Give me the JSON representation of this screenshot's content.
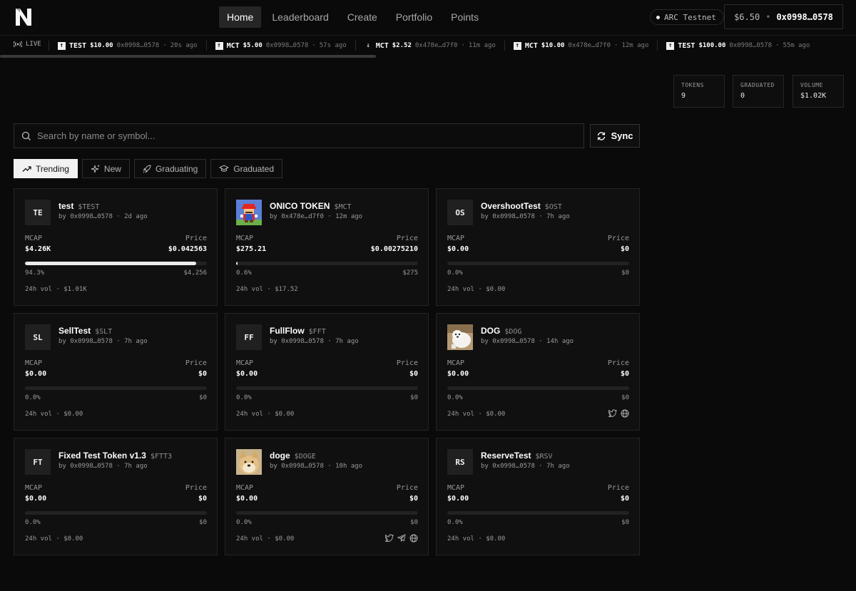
{
  "nav": {
    "items": [
      {
        "label": "Home",
        "active": true
      },
      {
        "label": "Leaderboard",
        "active": false
      },
      {
        "label": "Create",
        "active": false
      },
      {
        "label": "Portfolio",
        "active": false
      },
      {
        "label": "Points",
        "active": false
      }
    ]
  },
  "network": {
    "label": "ARC Testnet"
  },
  "wallet": {
    "balance": "$6.50",
    "separator": "•",
    "address": "0x0998…0578"
  },
  "ticker": {
    "live_label": "LIVE",
    "items": [
      {
        "direction": "up",
        "symbol": "TEST",
        "amount": "$10.00",
        "address": "0x0998…0578",
        "time": "20s ago"
      },
      {
        "direction": "up",
        "symbol": "MCT",
        "amount": "$5.00",
        "address": "0x0998…0578",
        "time": "57s ago"
      },
      {
        "direction": "down",
        "symbol": "MCT",
        "amount": "$2.52",
        "address": "0x478e…d7f0",
        "time": "11m ago"
      },
      {
        "direction": "up",
        "symbol": "MCT",
        "amount": "$10.00",
        "address": "0x478e…d7f0",
        "time": "12m ago"
      },
      {
        "direction": "up",
        "symbol": "TEST",
        "amount": "$100.00",
        "address": "0x0998…0578",
        "time": "55m ago"
      }
    ]
  },
  "stats": {
    "tokens": {
      "label": "TOKENS",
      "value": "9"
    },
    "graduated": {
      "label": "GRADUATED",
      "value": "0"
    },
    "volume": {
      "label": "VOLUME",
      "value": "$1.02K"
    }
  },
  "search": {
    "placeholder": "Search by name or symbol...",
    "value": ""
  },
  "sync_label": "Sync",
  "filters": [
    {
      "label": "Trending",
      "active": true,
      "icon": "trending-icon"
    },
    {
      "label": "New",
      "active": false,
      "icon": "sparkle-icon"
    },
    {
      "label": "Graduating",
      "active": false,
      "icon": "rocket-icon"
    },
    {
      "label": "Graduated",
      "active": false,
      "icon": "graduation-cap-icon"
    }
  ],
  "labels": {
    "mcap": "MCAP",
    "price": "Price",
    "vol_prefix": "24h vol",
    "dot": "·",
    "by": "by"
  },
  "tokens": [
    {
      "initials": "TE",
      "image": null,
      "name": "test",
      "symbol": "$TEST",
      "creator": "0x0998…0578",
      "age": "2d ago",
      "mcap": "$4.26K",
      "price": "$0.042563",
      "progress_pct": 94.3,
      "progress_label": "94.3%",
      "goal": "$4,256",
      "vol": "$1.01K",
      "socials": []
    },
    {
      "initials": "",
      "image": "mario",
      "name": "ONICO TOKEN",
      "symbol": "$MCT",
      "creator": "0x478e…d7f0",
      "age": "12m ago",
      "mcap": "$275.21",
      "price": "$0.00275210",
      "progress_pct": 0.6,
      "progress_label": "0.6%",
      "goal": "$275",
      "vol": "$17.52",
      "socials": []
    },
    {
      "initials": "OS",
      "image": null,
      "name": "OvershootTest",
      "symbol": "$OST",
      "creator": "0x0998…0578",
      "age": "7h ago",
      "mcap": "$0.00",
      "price": "$0",
      "progress_pct": 0,
      "progress_label": "0.0%",
      "goal": "$0",
      "vol": "$0.00",
      "socials": []
    },
    {
      "initials": "SL",
      "image": null,
      "name": "SellTest",
      "symbol": "$SLT",
      "creator": "0x0998…0578",
      "age": "7h ago",
      "mcap": "$0.00",
      "price": "$0",
      "progress_pct": 0,
      "progress_label": "0.0%",
      "goal": "$0",
      "vol": "$0.00",
      "socials": []
    },
    {
      "initials": "FF",
      "image": null,
      "name": "FullFlow",
      "symbol": "$FFT",
      "creator": "0x0998…0578",
      "age": "7h ago",
      "mcap": "$0.00",
      "price": "$0",
      "progress_pct": 0,
      "progress_label": "0.0%",
      "goal": "$0",
      "vol": "$0.00",
      "socials": []
    },
    {
      "initials": "",
      "image": "dog",
      "name": "DOG",
      "symbol": "$DOG",
      "creator": "0x0998…0578",
      "age": "14h ago",
      "mcap": "$0.00",
      "price": "$0",
      "progress_pct": 0,
      "progress_label": "0.0%",
      "goal": "$0",
      "vol": "$0.00",
      "socials": [
        "twitter-icon",
        "globe-icon"
      ]
    },
    {
      "initials": "FT",
      "image": null,
      "name": "Fixed Test Token v1.3",
      "symbol": "$FTT3",
      "creator": "0x0998…0578",
      "age": "7h ago",
      "mcap": "$0.00",
      "price": "$0",
      "progress_pct": 0,
      "progress_label": "0.0%",
      "goal": "$0",
      "vol": "$0.00",
      "socials": []
    },
    {
      "initials": "",
      "image": "doge",
      "name": "doge",
      "symbol": "$DOGE",
      "creator": "0x0998…0578",
      "age": "10h ago",
      "mcap": "$0.00",
      "price": "$0",
      "progress_pct": 0,
      "progress_label": "0.0%",
      "goal": "$0",
      "vol": "$0.00",
      "socials": [
        "twitter-icon",
        "telegram-icon",
        "globe-icon"
      ]
    },
    {
      "initials": "RS",
      "image": null,
      "name": "ReserveTest",
      "symbol": "$RSV",
      "creator": "0x0998…0578",
      "age": "7h ago",
      "mcap": "$0.00",
      "price": "$0",
      "progress_pct": 0,
      "progress_label": "0.0%",
      "goal": "$0",
      "vol": "$0.00",
      "socials": []
    }
  ]
}
